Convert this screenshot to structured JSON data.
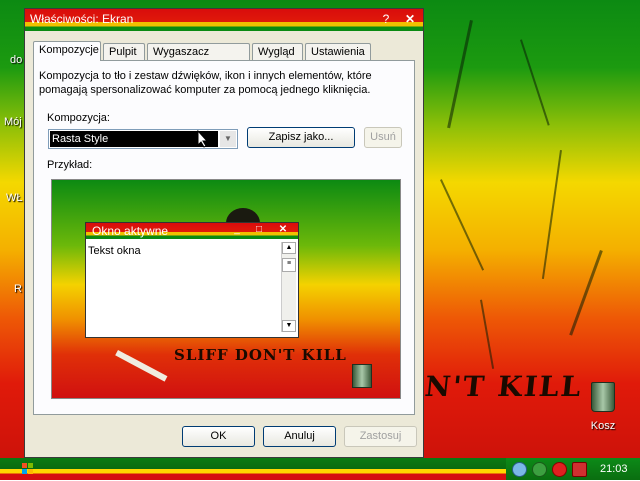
{
  "desktop": {
    "edge_labels": [
      "do",
      "Mój",
      "WŁ",
      "R"
    ],
    "background_text": "N'T KILL",
    "recycle_bin_label": "Kosz"
  },
  "taskbar": {
    "clock": "21:03",
    "tray_icons": [
      "network-icon",
      "security-shield-icon",
      "stop-icon",
      "alert-shield-icon"
    ],
    "colors": {
      "green": "#0a7a12",
      "yellow": "#ffd800",
      "red": "#d51010"
    }
  },
  "dialog": {
    "title": "Właściwości: Ekran",
    "help_button": "?",
    "close_button": "✕",
    "tabs": [
      "Kompozycje",
      "Pulpit",
      "Wygaszacz ekranu",
      "Wygląd",
      "Ustawienia"
    ],
    "active_tab": "Kompozycje",
    "description": "Kompozycja to tło i zestaw dźwięków, ikon i innych elementów, które pomagają spersonalizować komputer za pomocą jednego kliknięcia.",
    "theme_label": "Kompozycja:",
    "theme_value": "Rasta Style",
    "save_as_button": "Zapisz jako...",
    "delete_button": "Usuń",
    "preview_label": "Przykład:",
    "preview": {
      "wallpaper_text": "SLIFF DON'T KILL",
      "window_title": "Okno aktywne",
      "window_text": "Tekst okna"
    },
    "ok_button": "OK",
    "cancel_button": "Anuluj",
    "apply_button": "Zastosuj"
  }
}
